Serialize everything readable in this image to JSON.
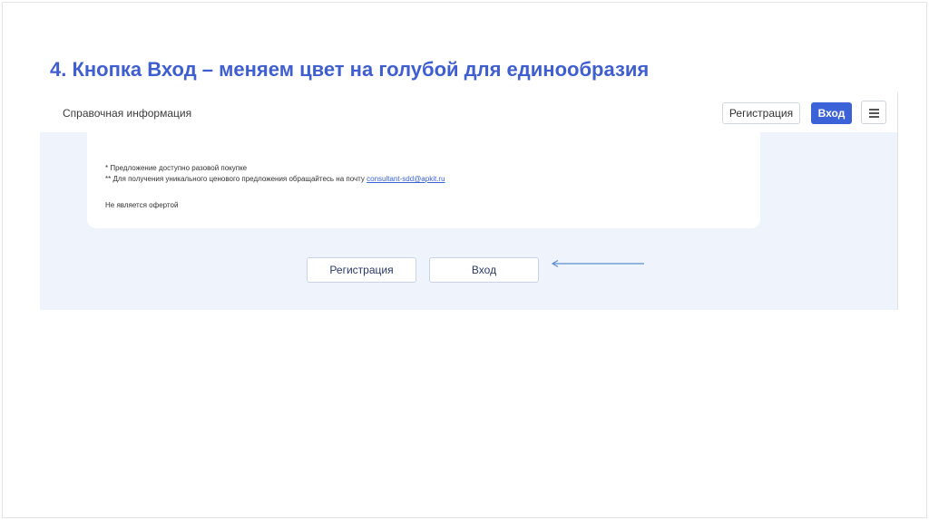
{
  "slide": {
    "title": "4. Кнопка Вход – меняем цвет на голубой для единообразия"
  },
  "header": {
    "title": "Справочная информация",
    "register_label": "Регистрация",
    "login_label": "Вход",
    "menu_icon": "hamburger-menu-icon"
  },
  "card": {
    "note1": "* Предложение доступно разовой покупке",
    "note2_prefix": "** Для получения уникального ценового предложения обращайтесь на почту ",
    "note2_email": "consultant-sdd@apkit.ru",
    "note3": "Не является офертой"
  },
  "bottom": {
    "register_label": "Регистрация",
    "login_label": "Вход"
  },
  "colors": {
    "title": "#3f5fd0",
    "accent_blue": "#3b62d6",
    "content_bg": "#eff3fb",
    "arrow": "#5a8ed0"
  }
}
